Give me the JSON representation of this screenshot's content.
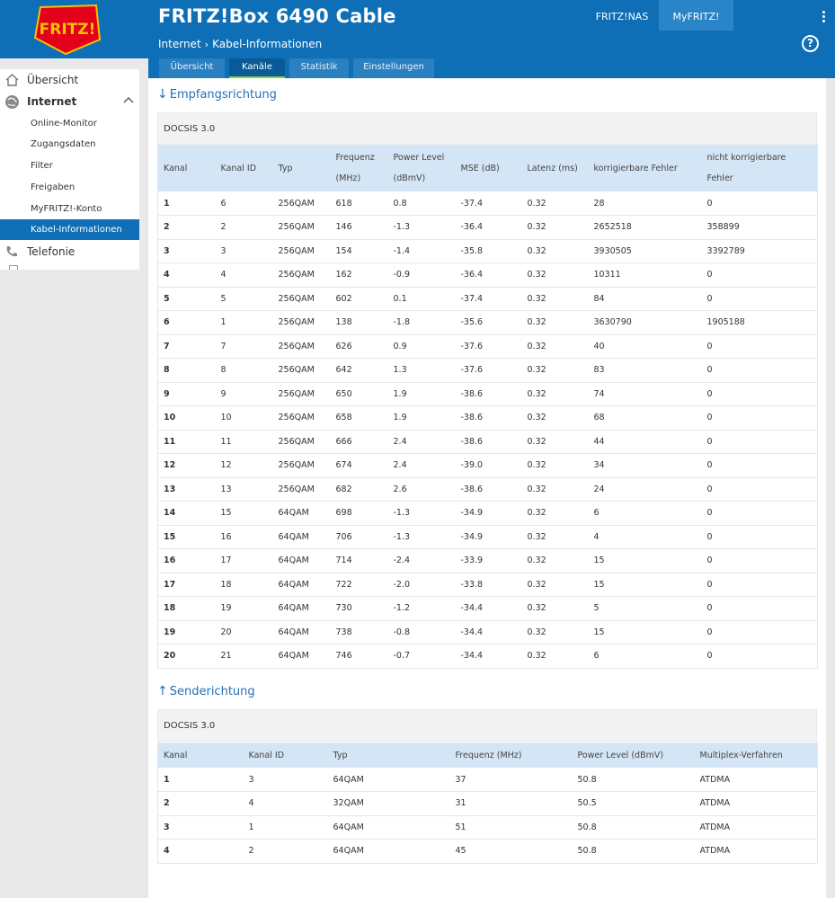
{
  "header": {
    "title": "FRITZ!Box 6490 Cable",
    "logo_text": "FRITZ!",
    "links": [
      "FRITZ!NAS",
      "MyFRITZ!"
    ]
  },
  "breadcrumb": [
    "Internet",
    "Kabel-Informationen"
  ],
  "tabs": [
    {
      "label": "Übersicht",
      "active": false
    },
    {
      "label": "Kanäle",
      "active": true
    },
    {
      "label": "Statistik",
      "active": false
    },
    {
      "label": "Einstellungen",
      "active": false
    }
  ],
  "sidebar": {
    "items": [
      {
        "label": "Übersicht",
        "icon": "home-icon"
      },
      {
        "label": "Internet",
        "icon": "globe-icon"
      },
      {
        "label": "Telefonie",
        "icon": "phone-icon"
      }
    ],
    "subitems": [
      "Online-Monitor",
      "Zugangsdaten",
      "Filter",
      "Freigaben",
      "MyFRITZ!-Konto",
      "Kabel-Informationen"
    ],
    "active_subitem": "Kabel-Informationen"
  },
  "downstream": {
    "title": "Empfangsrichtung",
    "docsis": "DOCSIS 3.0",
    "headers": [
      "Kanal",
      "Kanal ID",
      "Typ",
      "Frequenz (MHz)",
      "Power Level (dBmV)",
      "MSE (dB)",
      "Latenz (ms)",
      "korrigierbare Fehler",
      "nicht korrigierbare Fehler"
    ],
    "rows": [
      [
        "1",
        "6",
        "256QAM",
        "618",
        "0.8",
        "-37.4",
        "0.32",
        "28",
        "0"
      ],
      [
        "2",
        "2",
        "256QAM",
        "146",
        "-1.3",
        "-36.4",
        "0.32",
        "2652518",
        "358899"
      ],
      [
        "3",
        "3",
        "256QAM",
        "154",
        "-1.4",
        "-35.8",
        "0.32",
        "3930505",
        "3392789"
      ],
      [
        "4",
        "4",
        "256QAM",
        "162",
        "-0.9",
        "-36.4",
        "0.32",
        "10311",
        "0"
      ],
      [
        "5",
        "5",
        "256QAM",
        "602",
        "0.1",
        "-37.4",
        "0.32",
        "84",
        "0"
      ],
      [
        "6",
        "1",
        "256QAM",
        "138",
        "-1.8",
        "-35.6",
        "0.32",
        "3630790",
        "1905188"
      ],
      [
        "7",
        "7",
        "256QAM",
        "626",
        "0.9",
        "-37.6",
        "0.32",
        "40",
        "0"
      ],
      [
        "8",
        "8",
        "256QAM",
        "642",
        "1.3",
        "-37.6",
        "0.32",
        "83",
        "0"
      ],
      [
        "9",
        "9",
        "256QAM",
        "650",
        "1.9",
        "-38.6",
        "0.32",
        "74",
        "0"
      ],
      [
        "10",
        "10",
        "256QAM",
        "658",
        "1.9",
        "-38.6",
        "0.32",
        "68",
        "0"
      ],
      [
        "11",
        "11",
        "256QAM",
        "666",
        "2.4",
        "-38.6",
        "0.32",
        "44",
        "0"
      ],
      [
        "12",
        "12",
        "256QAM",
        "674",
        "2.4",
        "-39.0",
        "0.32",
        "34",
        "0"
      ],
      [
        "13",
        "13",
        "256QAM",
        "682",
        "2.6",
        "-38.6",
        "0.32",
        "24",
        "0"
      ],
      [
        "14",
        "15",
        "64QAM",
        "698",
        "-1.3",
        "-34.9",
        "0.32",
        "6",
        "0"
      ],
      [
        "15",
        "16",
        "64QAM",
        "706",
        "-1.3",
        "-34.9",
        "0.32",
        "4",
        "0"
      ],
      [
        "16",
        "17",
        "64QAM",
        "714",
        "-2.4",
        "-33.9",
        "0.32",
        "15",
        "0"
      ],
      [
        "17",
        "18",
        "64QAM",
        "722",
        "-2.0",
        "-33.8",
        "0.32",
        "15",
        "0"
      ],
      [
        "18",
        "19",
        "64QAM",
        "730",
        "-1.2",
        "-34.4",
        "0.32",
        "5",
        "0"
      ],
      [
        "19",
        "20",
        "64QAM",
        "738",
        "-0.8",
        "-34.4",
        "0.32",
        "15",
        "0"
      ],
      [
        "20",
        "21",
        "64QAM",
        "746",
        "-0.7",
        "-34.4",
        "0.32",
        "6",
        "0"
      ]
    ]
  },
  "upstream": {
    "title": "Senderichtung",
    "docsis": "DOCSIS 3.0",
    "headers": [
      "Kanal",
      "Kanal ID",
      "Typ",
      "Frequenz (MHz)",
      "Power Level (dBmV)",
      "Multiplex-Verfahren"
    ],
    "rows": [
      [
        "1",
        "3",
        "64QAM",
        "37",
        "50.8",
        "ATDMA"
      ],
      [
        "2",
        "4",
        "32QAM",
        "31",
        "50.5",
        "ATDMA"
      ],
      [
        "3",
        "1",
        "64QAM",
        "51",
        "50.8",
        "ATDMA"
      ],
      [
        "4",
        "2",
        "64QAM",
        "45",
        "50.8",
        "ATDMA"
      ]
    ]
  },
  "colors": {
    "brand_blue": "#0e6eb6",
    "active_tab_underline": "#8bd14a",
    "header_row": "#d4e5f5",
    "logo_red": "#e2001a"
  }
}
